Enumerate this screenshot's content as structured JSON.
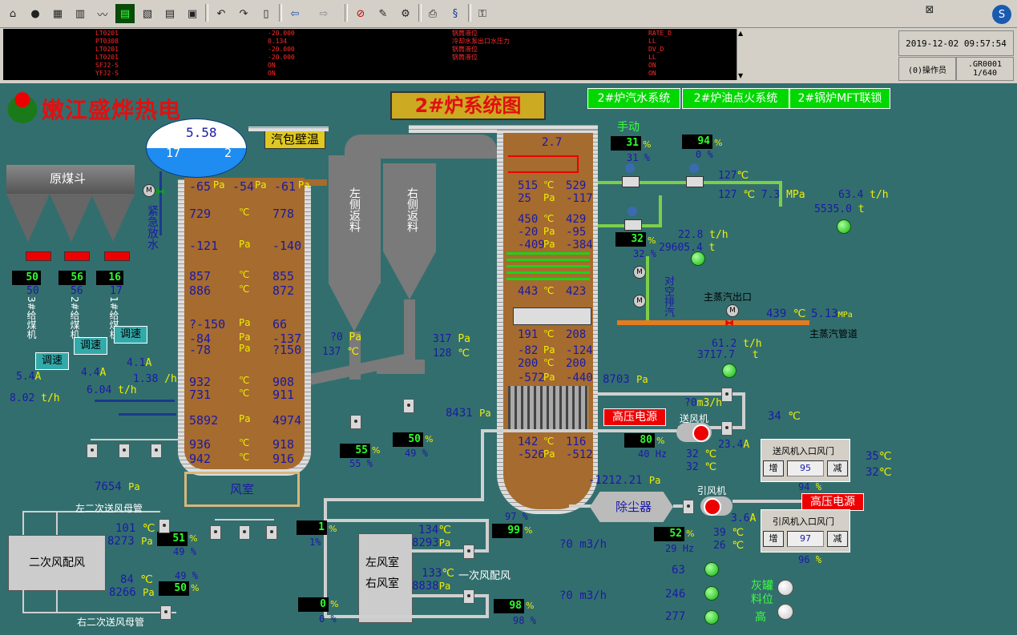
{
  "toolbar": {
    "icons": [
      "home-icon",
      "record-icon",
      "grid-icon",
      "bars-icon",
      "trend-icon",
      "chart-icon",
      "report-icon",
      "table-icon",
      "layout-icon",
      "undo-icon",
      "redo-icon",
      "book-icon",
      "back-icon",
      "forward-icon",
      "mute-icon",
      "edit-icon",
      "config-icon",
      "print-icon",
      "sync-icon",
      "user-key-icon"
    ]
  },
  "alarm": {
    "rows": [
      {
        "tag": "LT0201",
        "value": "-20.000",
        "desc": "锅筒液位",
        "state": "RATE_D"
      },
      {
        "tag": "PT0308",
        "value": "0.134",
        "desc": "冷却水泵出口水压力",
        "state": "LL"
      },
      {
        "tag": "LT0201",
        "value": "-20.000",
        "desc": "锅筒液位",
        "state": "DV_D"
      },
      {
        "tag": "LT0201",
        "value": "-20.000",
        "desc": "锅筒液位",
        "state": "LL"
      },
      {
        "tag": "SFJ2-S",
        "value": "ON",
        "desc": "",
        "state": "ON"
      },
      {
        "tag": "YFJ2-S",
        "value": "ON",
        "desc": "",
        "state": "ON"
      }
    ]
  },
  "status": {
    "datetime": "2019-12-02 09:57:54",
    "operator": "(0)操作员",
    "group": ".GR0001",
    "page": "1/640"
  },
  "logo": "嫩江盛烨热电",
  "title": "2#炉系统图",
  "nav": {
    "water": "2#炉汽水系统",
    "oil": "2#炉油点火系统",
    "mft": "2#锅炉MFT联锁"
  },
  "drum": {
    "label": "汽包壁温",
    "pressure": "5.58",
    "left": "17",
    "right": "2"
  },
  "emergency_drain": "紧急放水",
  "coal_hopper": "原煤斗",
  "feeders": [
    {
      "led": "50",
      "val": "50",
      "name": "3#给煤机",
      "tune": "调速"
    },
    {
      "led": "56",
      "val": "56",
      "name": "2#给煤机",
      "tune": "调速"
    },
    {
      "led": "16",
      "val": "17",
      "name": "1#给煤机",
      "tune": "调速"
    }
  ],
  "feeder_extra": {
    "tune3": "调速",
    "a1": "5.4",
    "a2": "4.4",
    "a3": "4.1",
    "u_a": "A",
    "flow": "8.02",
    "flow2": "6.04",
    "flow3": "1.38",
    "u_th": "t/h",
    "u_h": "/h"
  },
  "furnace": {
    "rows": [
      [
        "-65",
        "Pa",
        "-54",
        "Pa",
        "-61",
        "Pa"
      ],
      [
        "729",
        "℃",
        "778"
      ],
      [
        "-121",
        "Pa",
        "-140"
      ],
      [
        "857",
        "℃",
        "855"
      ],
      [
        "886",
        "℃",
        "872"
      ],
      [
        "?-150",
        "Pa",
        "66"
      ],
      [
        "-84",
        "Pa",
        "-137"
      ],
      [
        "-78",
        "Pa",
        "?150"
      ],
      [
        "932",
        "℃",
        "908"
      ],
      [
        "731",
        "℃",
        "911"
      ],
      [
        "5892",
        "Pa",
        "4974"
      ],
      [
        "936",
        "℃",
        "918"
      ],
      [
        "942",
        "℃",
        "916"
      ]
    ],
    "windbox": "风室",
    "windbox_p": "7654",
    "u_pa": "Pa"
  },
  "cyclones": {
    "left": "左侧返料",
    "right": "右侧返料",
    "p": "?0",
    "t": "137",
    "p2": "317",
    "t2": "128",
    "u_pa": "Pa",
    "u_c": "℃"
  },
  "valves_bottom": {
    "v1": "55",
    "v1s": "55",
    "v2": "50",
    "v2s": "49",
    "pct": "%"
  },
  "backpass": {
    "top": "2.7",
    "rows": [
      [
        "515",
        "℃",
        "529"
      ],
      [
        "25",
        "Pa",
        "-117"
      ],
      [
        "450",
        "℃",
        "429"
      ],
      [
        "-20",
        "Pa",
        "-95"
      ],
      [
        "-409",
        "Pa",
        "-384"
      ],
      [
        "443",
        "℃",
        "423"
      ],
      [
        "191",
        "℃",
        "208"
      ],
      [
        "-82",
        "Pa",
        "-124"
      ],
      [
        "200",
        "℃",
        "200"
      ],
      [
        "-572",
        "Pa",
        "-440"
      ],
      [
        "142",
        "℃",
        "116"
      ],
      [
        "-526",
        "Pa",
        "-512"
      ]
    ],
    "p1": "8703",
    "p2": "8431",
    "outlet": "-1212.21",
    "u_pa": "Pa"
  },
  "steam": {
    "manual": "手动",
    "led1": "31",
    "v1": "31",
    "led2": "94",
    "v2": "0",
    "pct": "%",
    "t1": "127",
    "t2": "127",
    "p": "7.3",
    "u_mpa": "MPa",
    "flow1": "63.4",
    "u_th": "t/h",
    "total1": "5535.0",
    "u_t": "t",
    "led3": "32",
    "v3": "32",
    "flow2": "22.8",
    "total2": "29605.4",
    "vent": "对空排汽",
    "main_out": "主蒸汽出口",
    "main_t": "439",
    "main_p": "5.13",
    "main_pipe": "主蒸汽管道",
    "flow3": "61.2",
    "total3": "3717.7"
  },
  "fans": {
    "hv1": "高压电源",
    "fan1": "送风机",
    "flow_q": "?0",
    "u_m3h": "m3/h",
    "t_air": "34",
    "led_hz1": "80",
    "hz1": "40",
    "u_hz": "Hz",
    "amp1": "23.4",
    "t1a": "32",
    "t1b": "32",
    "u_c": "℃",
    "u_a": "A",
    "panel1_title": "送风机入口风门",
    "panel1_val": "95",
    "inc": "增",
    "dec": "减",
    "p1_v1": "35",
    "p1_v2": "32",
    "dust": "除尘器",
    "fan2": "引风机",
    "hv2": "高压电源",
    "p94": "94",
    "amp2": "3.6",
    "led_hz2": "52",
    "hz2": "29",
    "t2a": "39",
    "t2b": "26",
    "panel2_title": "引风机入口风门",
    "panel2_val": "97",
    "p96": "96",
    "flow_q2": "?0",
    "flow_q3": "?0"
  },
  "secondary": {
    "label": "二次风配风",
    "left_bus": "左二次送风母管",
    "right_bus": "右二次送风母管",
    "t1": "101",
    "p1": "8273",
    "led1": "51",
    "v1": "49",
    "t2": "84",
    "p2": "8266",
    "led2": "50",
    "v2": "49"
  },
  "primary": {
    "left": "左风室",
    "right": "右风室",
    "t1": "134",
    "p1": "8293",
    "t2": "133",
    "p2": "8838",
    "label": "一次风配风",
    "led_a": "1",
    "va": "1",
    "led_b": "0",
    "vb": "0",
    "led_c": "99",
    "vc": "97",
    "led_d": "98",
    "vd": "98"
  },
  "ash": {
    "label": "灰罐料位",
    "level": "高",
    "v1": "63",
    "v2": "246",
    "v3": "277"
  }
}
